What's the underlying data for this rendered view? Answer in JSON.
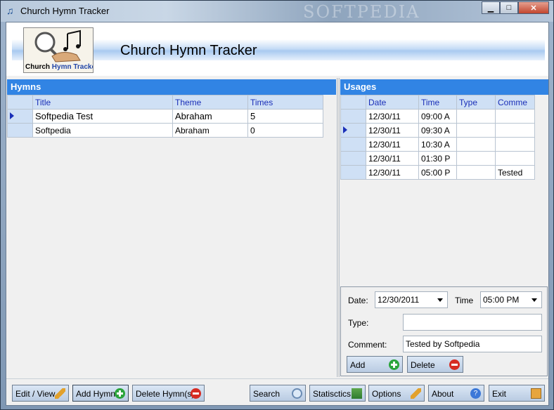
{
  "window": {
    "title": "Church Hymn Tracker",
    "watermark": "SOFTPEDIA",
    "controls": {
      "minimize": "▁",
      "maximize": "□",
      "close": "✕"
    }
  },
  "header": {
    "title": "Church Hymn Tracker",
    "logo_text_1": "Church",
    "logo_text_2": "Hymn Tracker"
  },
  "hymns": {
    "panel_title": "Hymns",
    "columns": [
      "Title",
      "Theme",
      "Times"
    ],
    "rows": [
      {
        "title": "Softpedia Test",
        "theme": "Abraham",
        "times": "5"
      },
      {
        "title": "Softpedia",
        "theme": "Abraham",
        "times": "0"
      }
    ]
  },
  "usages": {
    "panel_title": "Usages",
    "columns": [
      "Date",
      "Time",
      "Type",
      "Comme"
    ],
    "rows": [
      {
        "date": "12/30/11",
        "time": "09:00 A",
        "type": "",
        "comment": ""
      },
      {
        "date": "12/30/11",
        "time": "09:30 A",
        "type": "",
        "comment": ""
      },
      {
        "date": "12/30/11",
        "time": "10:30 A",
        "type": "",
        "comment": ""
      },
      {
        "date": "12/30/11",
        "time": "01:30 P",
        "type": "",
        "comment": ""
      },
      {
        "date": "12/30/11",
        "time": "05:00 P",
        "type": "",
        "comment": "Tested"
      }
    ]
  },
  "detail": {
    "date_label": "Date:",
    "date_value": "12/30/2011",
    "time_label": "Time",
    "time_value": "05:00 PM",
    "type_label": "Type:",
    "type_value": "",
    "comment_label": "Comment:",
    "comment_value": "Tested by Softpedia",
    "add_label": "Add",
    "delete_label": "Delete"
  },
  "toolbar": {
    "edit_view": "Edit / View",
    "add_hymn": "Add Hymn",
    "delete_hymns": "Delete Hymn(s)",
    "search": "Search",
    "statistics": "Statisctics",
    "options": "Options",
    "about": "About",
    "exit": "Exit"
  },
  "colors": {
    "panel_header": "#3184e4",
    "grid_header": "#cfe0f5",
    "grid_header_text": "#1a2fb8"
  }
}
